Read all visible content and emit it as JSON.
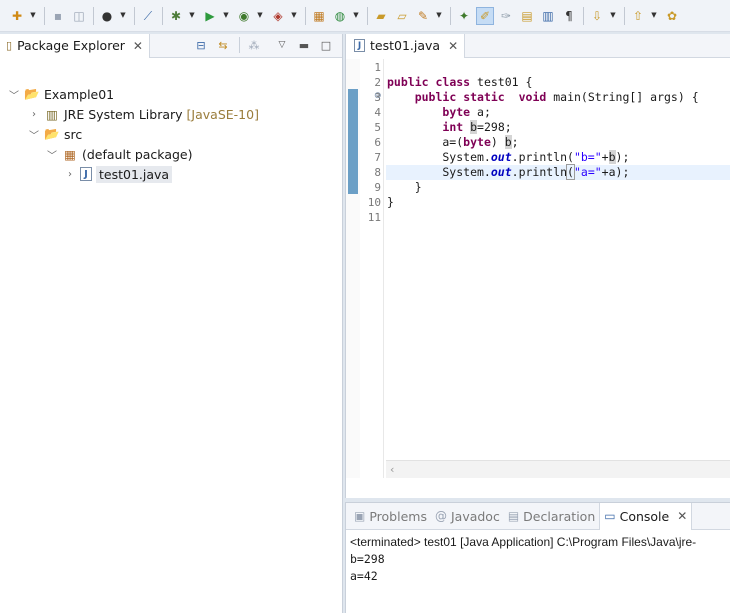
{
  "toolbar": {
    "icons": [
      "new-wizard-icon",
      "save-icon",
      "save-all-icon",
      "profile-icon",
      "skip-breakpoints-icon",
      "debug-icon",
      "run-icon",
      "coverage-icon",
      "external-tools-icon",
      "new-java-package-icon",
      "new-java-class-icon",
      "open-type-icon",
      "open-task-icon",
      "search-icon",
      "pin-icon",
      "mark-occurrences-icon",
      "block-selection-icon",
      "show-whitespace-icon",
      "next-annotation-icon",
      "previous-annotation-icon",
      "last-edit-icon"
    ]
  },
  "package_explorer": {
    "title": "Package Explorer",
    "tree": [
      {
        "label": "Example01",
        "decoration": "",
        "icon": "java-project-icon",
        "expanded": true
      },
      {
        "label": "JRE System Library",
        "decoration": "[JavaSE-10]",
        "icon": "library-icon",
        "expanded": false
      },
      {
        "label": "src",
        "decoration": "",
        "icon": "source-folder-icon",
        "expanded": true
      },
      {
        "label": "(default package)",
        "decoration": "",
        "icon": "package-icon",
        "expanded": true
      },
      {
        "label": "test01.java",
        "decoration": "",
        "icon": "java-file-icon",
        "expanded": false
      }
    ]
  },
  "editor": {
    "tab_label": "test01.java",
    "line_numbers": [
      "1",
      "2",
      "3",
      "4",
      "5",
      "6",
      "7",
      "8",
      "9",
      "10",
      "11"
    ],
    "current_line": 8
  },
  "console": {
    "tabs": [
      {
        "label": "Problems",
        "active": false
      },
      {
        "label": "Javadoc",
        "active": false
      },
      {
        "label": "Declaration",
        "active": false
      },
      {
        "label": "Console",
        "active": true
      }
    ],
    "status": "<terminated> test01 [Java Application] C:\\Program Files\\Java\\jre-",
    "output": [
      "b=298",
      "a=42"
    ]
  },
  "colors": {
    "keyword": "#7f0055",
    "string": "#2a00ff",
    "field": "#0000c0",
    "current_line_bg": "#e8f2fe",
    "selection_bg": "#c5dcf5"
  }
}
